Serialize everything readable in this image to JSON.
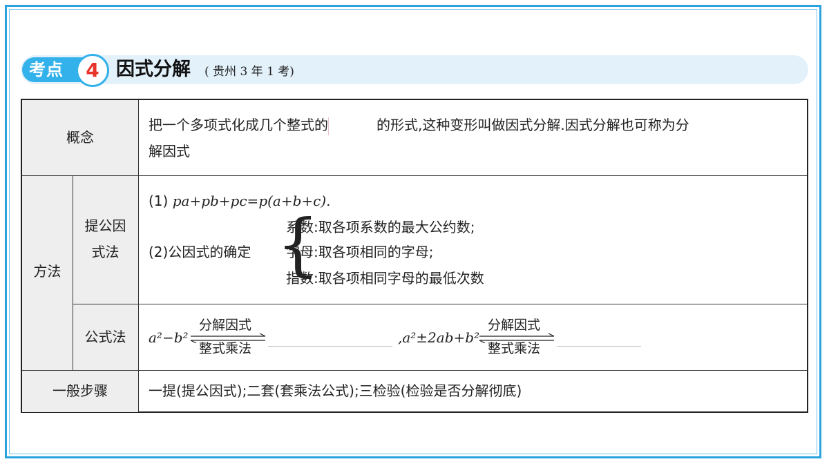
{
  "heading": {
    "tag": "考点",
    "number": "4",
    "title": "因式分解",
    "source": "( 贵州 3 年 1 考)"
  },
  "concept": {
    "label": "概念",
    "text_before": "把一个多项式化成几个整式的",
    "text_after": "的形式,这种变形叫做因式分解.因式分解也可称为分",
    "text_line2": "解因式"
  },
  "method": {
    "label": "方法",
    "common_factor": {
      "label_line1": "提公因",
      "label_line2": "式法",
      "item1_prefix": "(1)",
      "item1_formula": "pa+pb+pc=p(a+b+c).",
      "item2_prefix": "(2)公因式的确定",
      "rules": [
        "系数:取各项系数的最大公约数;",
        "字母:取各项相同的字母;",
        "指数:取各项相同字母的最低次数"
      ]
    },
    "formula_method": {
      "label": "公式法",
      "expr1": "a²−b²",
      "expr2": ",a²±2ab+b²",
      "arrow_top": "分解因式",
      "arrow_bottom": "整式乘法"
    }
  },
  "steps": {
    "label": "一般步骤",
    "text": "一提(提公因式);二套(套乘法公式);三检验(检验是否分解彻底)"
  },
  "colors": {
    "frame": "#29a3e0",
    "accent": "#33b1ea",
    "number": "#e8332a",
    "shade": "#eeeeee"
  }
}
